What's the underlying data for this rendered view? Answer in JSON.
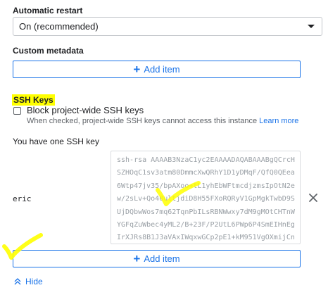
{
  "restart": {
    "label": "Automatic restart",
    "selected": "On (recommended)"
  },
  "metadata": {
    "label": "Custom metadata",
    "add_label": "Add item"
  },
  "ssh": {
    "heading": "SSH Keys",
    "block_label": "Block project-wide SSH keys",
    "block_help": "When checked, project-wide SSH keys cannot access this instance",
    "learn_more": "Learn more",
    "count_text": "You have one SSH key",
    "key_user": "eric",
    "key_lines": [
      "ssh-rsa AAAAB3NzaC1yc2EAAAADAQABAAABgQCrcH",
      "SZHOqC1sv3atm80DmmcXwQRhY1D1yDMqF/QfQ0QEea",
      "6Wtp47jv35/bpAXoo+tL1yhEbWFtmcdjzmsIpOtN2e",
      "w/2sLv+Qo40ultjdiD8H55FXoRQRyV1GpMgkTwbD9S",
      "UjDQbwWos7mq62TqnPbILsRBNWwxy7dM9gMOtCHTnW",
      "YGFqZuWbec4yML2/B+23F/P2UtL6PWp6P4SmEIHnEg",
      "IrXJRs8B1J3aVAxIWqxwGCp2pE1+kM951VgOXmijCn"
    ],
    "add_label": "Add item"
  },
  "hide_label": "Hide",
  "icons": {
    "dropdown": "chevron-down-icon",
    "delete": "close-icon",
    "add": "plus-icon",
    "collapse": "chevron-up-icon"
  },
  "colors": {
    "accent": "#1a73e8",
    "annotation": "#ffff00"
  }
}
